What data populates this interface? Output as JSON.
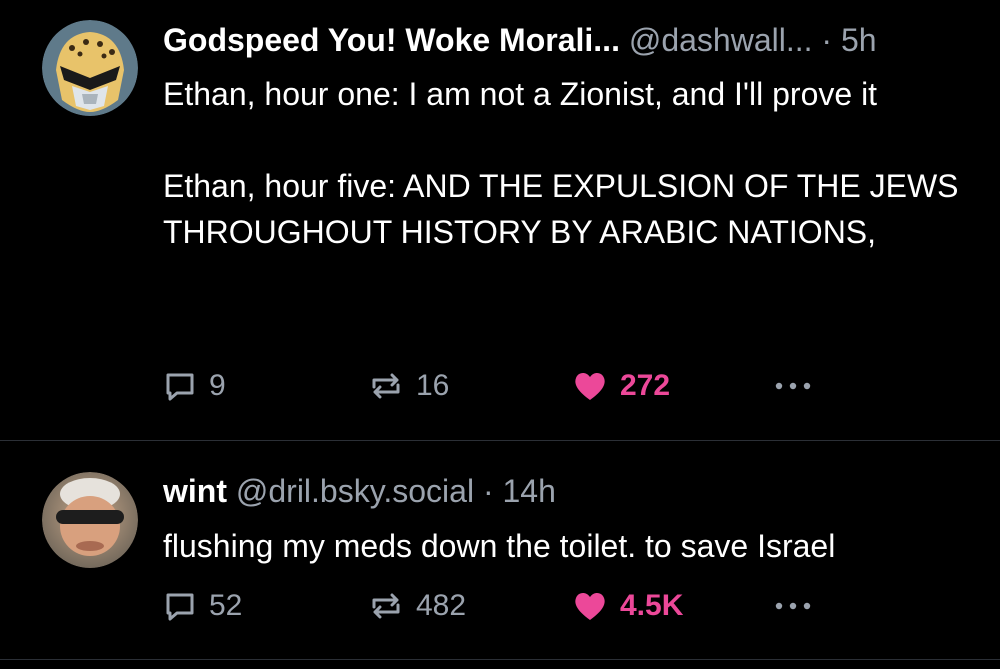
{
  "posts": [
    {
      "author_name": "Godspeed You! Woke Morali...",
      "handle": "@dashwall...",
      "separator": "·",
      "time": "5h",
      "text_lines": [
        "Ethan, hour one: I am not a Zionist, and I'll prove it",
        "Ethan, hour five: AND THE EXPULSION OF THE JEWS THROUGHOUT HISTORY BY ARABIC NATIONS,"
      ],
      "replies": "9",
      "reposts": "16",
      "likes": "272",
      "avatar_icon": "ranger-helmet-avatar"
    },
    {
      "author_name": "wint",
      "handle": "@dril.bsky.social",
      "separator": "·",
      "time": "14h",
      "text_lines": [
        "flushing my meds down the toilet. to save Israel"
      ],
      "replies": "52",
      "reposts": "482",
      "likes": "4.5K",
      "avatar_icon": "blurred-face-avatar"
    }
  ],
  "colors": {
    "background": "#000000",
    "text": "#ffffff",
    "muted": "#9ba3ae",
    "like": "#ec4899",
    "divider": "#2b2f36"
  },
  "icons": {
    "reply": "speech-bubble-icon",
    "repost": "repost-arrows-icon",
    "like": "heart-icon",
    "more": "ellipsis-icon"
  }
}
